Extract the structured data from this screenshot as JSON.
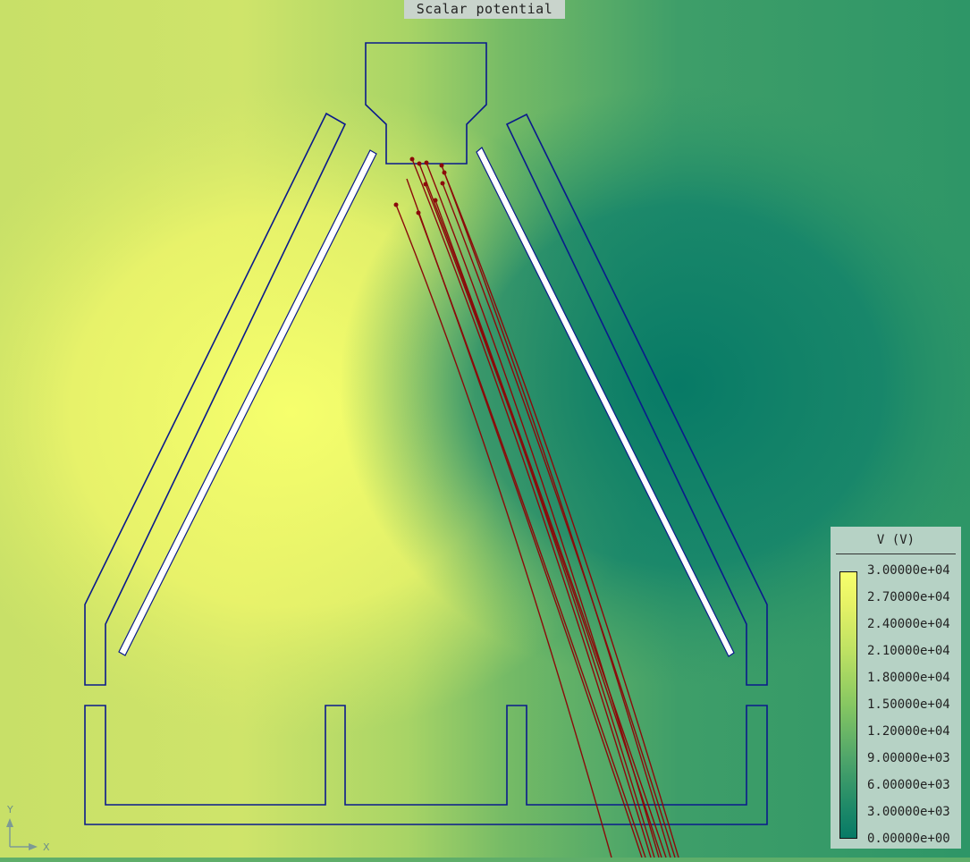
{
  "title": "Scalar potential",
  "legend": {
    "title": "V (V)",
    "ticks": [
      "3.00000e+04",
      "2.70000e+04",
      "2.40000e+04",
      "2.10000e+04",
      "1.80000e+04",
      "1.50000e+04",
      "1.20000e+04",
      "9.00000e+03",
      "6.00000e+03",
      "3.00000e+03",
      "0.00000e+00"
    ]
  },
  "axes": {
    "y_label": "Y",
    "x_label": "X"
  },
  "colors": {
    "high_potential": "#f6ff6c",
    "low_potential": "#077a66",
    "outline": "#0a1a8c",
    "trajectories": "#8b0a0a"
  }
}
